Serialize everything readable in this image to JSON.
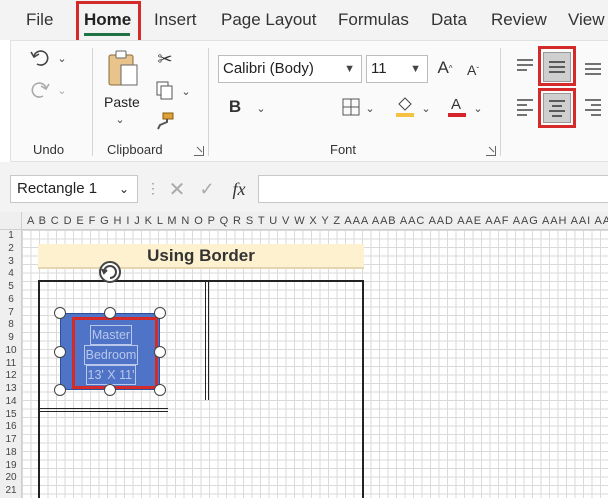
{
  "tabs": [
    {
      "label": "File",
      "active": false
    },
    {
      "label": "Home",
      "active": true
    },
    {
      "label": "Insert",
      "active": false
    },
    {
      "label": "Page Layout",
      "active": false
    },
    {
      "label": "Formulas",
      "active": false
    },
    {
      "label": "Data",
      "active": false
    },
    {
      "label": "Review",
      "active": false
    },
    {
      "label": "View",
      "active": false
    }
  ],
  "ribbon": {
    "undo": {
      "group_label": "Undo",
      "icons": [
        "undo-icon",
        "redo-icon"
      ]
    },
    "clipboard": {
      "group_label": "Clipboard",
      "paste_label": "Paste",
      "icons": [
        "paste-icon",
        "cut-icon",
        "copy-icon",
        "format-painter-icon"
      ]
    },
    "font": {
      "group_label": "Font",
      "font_name": "Calibri (Body)",
      "font_size": "11",
      "icons": [
        "bold-icon",
        "borders-icon",
        "fill-color-icon",
        "font-color-icon",
        "increase-font-icon",
        "decrease-font-icon"
      ]
    },
    "alignment": {
      "icons": [
        "align-top-icon",
        "align-middle-icon",
        "align-bottom-icon",
        "align-left-icon",
        "align-center-icon",
        "align-right-icon"
      ]
    }
  },
  "formula_bar": {
    "name_box": "Rectangle 1",
    "fx_label": "fx",
    "content": ""
  },
  "grid": {
    "column_headers": "A B C D E F G H I J K L M N O P Q R S T U V W X Y Z AAA AAB AAC AAD AAE AAF AAG AAH AAI AAJ AAK AAL AAM AAN AAO AAP AAQ AAR AAS AAT AAU",
    "row_numbers": [
      "1",
      "2",
      "3",
      "4",
      "5",
      "6",
      "7",
      "8",
      "9",
      "10",
      "11",
      "12",
      "13",
      "14",
      "15",
      "16",
      "17",
      "18",
      "19",
      "20",
      "21"
    ],
    "title_cell": "Using Border"
  },
  "shape": {
    "line1": "Master",
    "line2": "Bedroom",
    "line3": "13' X 11'",
    "fill_color": "#4e73c7"
  },
  "colors": {
    "accent": "#217346",
    "highlight": "#d42a2a"
  }
}
